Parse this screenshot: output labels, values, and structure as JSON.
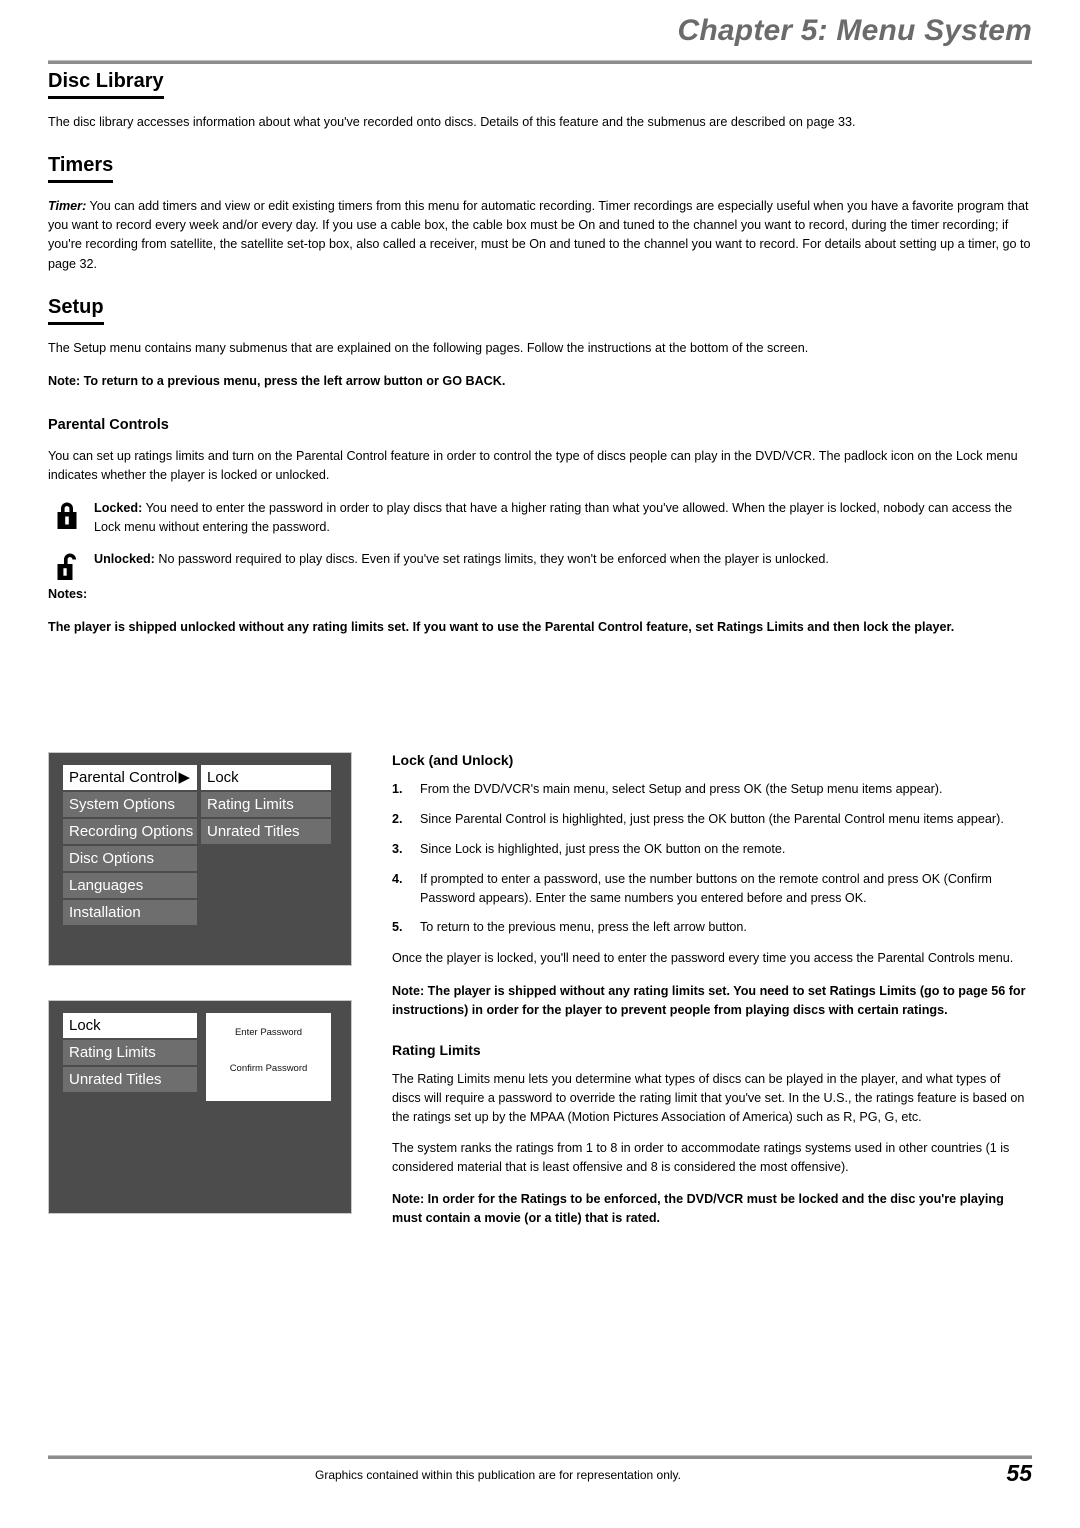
{
  "header": {
    "chapter_title": "Chapter 5: Menu System"
  },
  "sections": {
    "disc_library": {
      "heading": "Disc Library",
      "paragraph": "The disc library accesses information about what you've recorded onto discs. Details of this feature and the submenus are described on page 33."
    },
    "timers": {
      "heading": "Timers",
      "lead_label": "Timer:",
      "paragraph": "You can add timers and view or edit existing timers from this menu for automatic recording. Timer recordings are especially useful when you have a favorite program that you want to record every week and/or every day. If you use a cable box, the cable box must be On and tuned to the channel you want to record, during the timer recording; if you're recording from satellite, the satellite set-top box, also called a receiver, must be On and tuned to the channel you want to record. For details about setting up a timer, go to page 32."
    },
    "setup": {
      "heading": "Setup",
      "paragraph": "The Setup menu contains many submenus that are explained on the following pages. Follow the instructions at the bottom of the screen.",
      "note": "Note: To return to a previous menu, press the left arrow button or GO BACK."
    },
    "parental_controls": {
      "heading": "Parental Controls",
      "paragraph": "You can set up ratings limits and turn on the Parental Control feature in order to control the type of discs people can play in the DVD/VCR. The padlock icon on the Lock menu indicates whether the player is locked or unlocked.",
      "locked_label": "Locked:",
      "locked_text": " You need to enter the password in order to play discs that have a higher rating than what you've allowed. When the player is locked, nobody can access the Lock menu without entering the password.",
      "unlocked_label": "Unlocked:",
      "unlocked_text": " No password required to play discs. Even if you've set ratings limits, they won't be enforced when the player is unlocked.",
      "notes_label": "Notes:",
      "notes_text": "The player is shipped unlocked without any rating limits set. If you want to use the Parental Control feature, set Ratings Limits and then lock the player."
    }
  },
  "menu_graphic_1": {
    "left_items": [
      {
        "label": "Parental Control",
        "selected": true,
        "arrow": "▶"
      },
      {
        "label": "System Options",
        "selected": false,
        "arrow": ""
      },
      {
        "label": "Recording Options",
        "selected": false,
        "arrow": ""
      },
      {
        "label": "Disc Options",
        "selected": false,
        "arrow": ""
      },
      {
        "label": "Languages",
        "selected": false,
        "arrow": ""
      },
      {
        "label": "Installation",
        "selected": false,
        "arrow": ""
      }
    ],
    "right_items": [
      {
        "label": "Lock",
        "selected": true
      },
      {
        "label": "Rating Limits",
        "selected": false
      },
      {
        "label": "Unrated Titles",
        "selected": false
      }
    ]
  },
  "menu_graphic_2": {
    "left_items": [
      {
        "label": "Lock",
        "selected": true
      },
      {
        "label": "Rating Limits",
        "selected": false
      },
      {
        "label": "Unrated Titles",
        "selected": false
      }
    ],
    "password_dialog": {
      "enter": "Enter Password",
      "confirm": "Confirm Password"
    }
  },
  "lock_and_unlock": {
    "heading": "Lock (and Unlock)",
    "steps": [
      {
        "num": "1.",
        "text": "From the DVD/VCR's main menu, select Setup and press OK (the Setup menu items appear)."
      },
      {
        "num": "2.",
        "text": "Since Parental Control is highlighted, just press the OK button (the Parental Control menu items appear)."
      },
      {
        "num": "3.",
        "text": "Since Lock is highlighted, just press the OK button on the remote."
      },
      {
        "num": "4.",
        "text": "If prompted to enter a password, use the number buttons on the remote control and press OK (Confirm Password appears). Enter the same numbers you entered before and press OK."
      },
      {
        "num": "5.",
        "text": "To return to the previous menu, press the left arrow button."
      }
    ],
    "closing": "Once the player is locked, you'll need to enter the password every time you access the Parental Controls menu.",
    "note": "Note: The player is shipped without any rating limits set. You need to set Ratings Limits (go to page 56 for instructions) in order for the player to prevent people from playing discs with certain ratings."
  },
  "rating_limits": {
    "heading": "Rating Limits",
    "paragraph_1": "The Rating Limits menu lets you determine what types of discs can be played in the player, and what types of discs will require a password to override the rating limit that you've set. In the U.S., the ratings feature is based on the ratings set up by the MPAA (Motion Pictures Association of America) such as R, PG, G, etc.",
    "paragraph_2": "The system ranks the ratings from 1 to 8 in order to accommodate ratings systems used in other countries (1 is considered material that is least offensive and 8 is considered the most offensive).",
    "note": "Note: In order for the Ratings to be enforced, the DVD/VCR must be locked and the disc you're playing must contain a movie (or a title) that is rated."
  },
  "footer": {
    "caption": "Graphics contained within this publication are for representation only.",
    "page_number": "55"
  },
  "colors": {
    "header_gray": "#6b6b6b",
    "rule_gray": "#8d8d8d",
    "menu_panel_bg": "#4c4c4c",
    "menu_item_bg": "#6e6e6e",
    "menu_item_selected_bg": "#ffffff"
  }
}
